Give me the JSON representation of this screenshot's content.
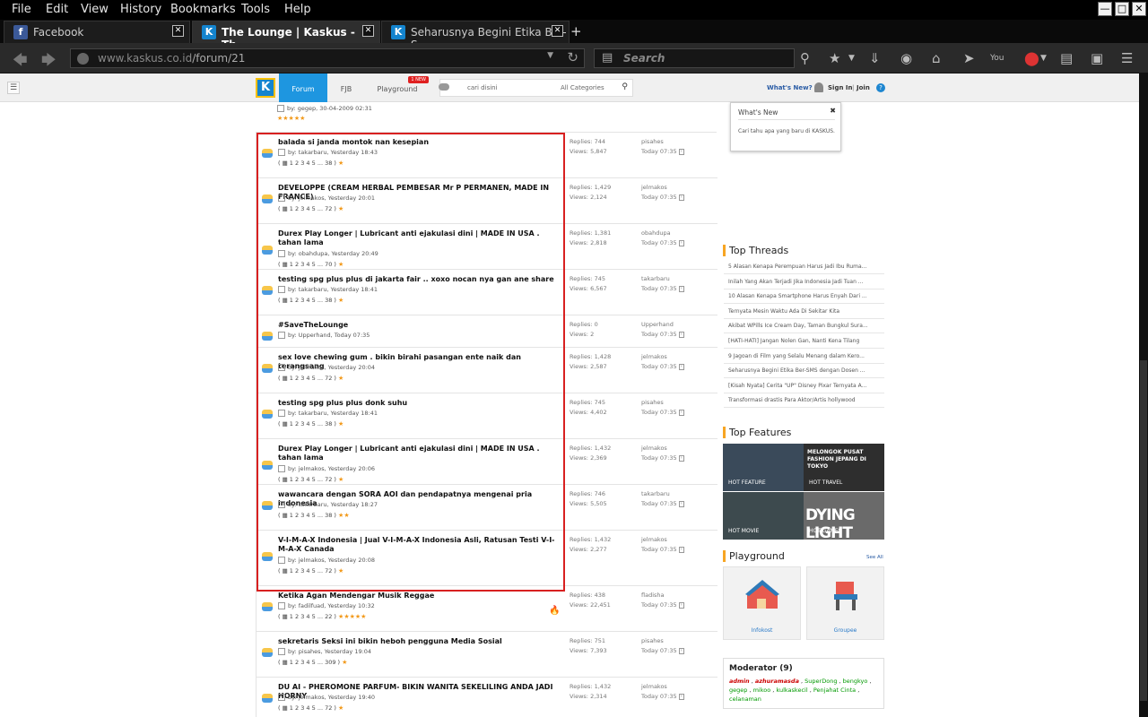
{
  "menu": [
    "File",
    "Edit",
    "View",
    "History",
    "Bookmarks",
    "Tools",
    "Help"
  ],
  "window_controls": [
    "—",
    "□",
    "✕"
  ],
  "tabs": [
    {
      "label": "Facebook",
      "icon": "facebook-icon",
      "icon_glyph": "f",
      "icon_color": "#3b5998"
    },
    {
      "label": "The Lounge | Kaskus - Th...",
      "icon": "kaskus-icon",
      "icon_glyph": "K",
      "icon_color": "#1484ce"
    },
    {
      "label": "Seharusnya Begini Etika Ber-S...",
      "icon": "kaskus-icon",
      "icon_glyph": "K",
      "icon_color": "#1484ce"
    }
  ],
  "tab_close": "✕",
  "new_tab": "+",
  "url": {
    "prefix": "www.kaskus.co.id",
    "path": "/forum/21"
  },
  "search_placeholder": "Search",
  "kaskus_nav": {
    "logo": "K",
    "forum": "Forum",
    "fjb": "FJB",
    "playground": "Playground",
    "new_badge": "1 NEW",
    "search_placeholder": "cari disini",
    "category": "All Categories",
    "whats_new": "What's New?",
    "signin": "Sign In",
    "sep": "|",
    "join": "Join",
    "help": "?"
  },
  "partial_row": {
    "meta": "by:  gegep, 30-04-2009 02:31",
    "stars": "★★★★★"
  },
  "threads": [
    {
      "title": "balada si janda montok nan kesepian",
      "by": "by:  takarbaru, Yesterday 18:43",
      "pages": "( ▦ 1  2  3  4  5 ... 38 )",
      "stars": "★",
      "replies": "Replies: 744",
      "views": "Views: 5,847",
      "last_user": "pisahes",
      "last_time": "Today 07:35"
    },
    {
      "title": "DEVELOPPE (CREAM HERBAL PEMBESAR Mr P PERMANEN, MADE IN FRANCE)",
      "by": "by:  jelmakos, Yesterday 20:01",
      "pages": "( ▦ 1  2  3  4  5 ... 72 )",
      "stars": "★",
      "replies": "Replies: 1,429",
      "views": "Views: 2,124",
      "last_user": "jelmakos",
      "last_time": "Today 07:35"
    },
    {
      "title": "Durex Play Longer | Lubricant anti ejakulasi dini | MADE IN USA . tahan lama",
      "by": "by:  obahdupa, Yesterday 20:49",
      "pages": "( ▦ 1  2  3  4  5 ... 70 )",
      "stars": "★",
      "replies": "Replies: 1,381",
      "views": "Views: 2,818",
      "last_user": "obahdupa",
      "last_time": "Today 07:35"
    },
    {
      "title": "testing spg plus plus di jakarta fair .. xoxo nocan nya gan ane share",
      "by": "by:  takarbaru, Yesterday 18:41",
      "pages": "( ▦ 1  2  3  4  5 ... 38 )",
      "stars": "★",
      "replies": "Replies: 745",
      "views": "Views: 6,567",
      "last_user": "takarbaru",
      "last_time": "Today 07:35"
    },
    {
      "title": "#SaveTheLounge",
      "by": "by:  Upperhand, Today 07:35",
      "pages": "",
      "stars": "",
      "replies": "Replies: 0",
      "views": "Views: 2",
      "last_user": "Upperhand",
      "last_time": "Today 07:35"
    },
    {
      "title": "sex love chewing gum . bikin birahi pasangan ente naik dan terangsang",
      "by": "by:  jelmakos, Yesterday 20:04",
      "pages": "( ▦ 1  2  3  4  5 ... 72 )",
      "stars": "★",
      "replies": "Replies: 1,428",
      "views": "Views: 2,587",
      "last_user": "jelmakos",
      "last_time": "Today 07:35"
    },
    {
      "title": "testing spg plus plus donk suhu",
      "by": "by:  takarbaru, Yesterday 18:41",
      "pages": "( ▦ 1  2  3  4  5 ... 38 )",
      "stars": "★",
      "replies": "Replies: 745",
      "views": "Views: 4,402",
      "last_user": "pisahes",
      "last_time": "Today 07:35"
    },
    {
      "title": "Durex Play Longer | Lubricant anti ejakulasi dini | MADE IN USA . tahan lama",
      "by": "by:  jelmakos, Yesterday 20:06",
      "pages": "( ▦ 1  2  3  4  5 ... 72 )",
      "stars": "★",
      "replies": "Replies: 1,432",
      "views": "Views: 2,369",
      "last_user": "jelmakos",
      "last_time": "Today 07:35"
    },
    {
      "title": "wawancara dengan SORA AOI dan pendapatnya mengenai pria indonesia",
      "by": "by:  takarbaru, Yesterday 18:27",
      "pages": "( ▦ 1  2  3  4  5 ... 38 )",
      "stars": "★★",
      "replies": "Replies: 746",
      "views": "Views: 5,505",
      "last_user": "takarbaru",
      "last_time": "Today 07:35"
    },
    {
      "title": "V-I-M-A-X Indonesia | Jual V-I-M-A-X Indonesia Asli, Ratusan Testi V-I-M-A-X Canada",
      "by": "by:  jelmakos, Yesterday 20:08",
      "pages": "( ▦ 1  2  3  4  5 ... 72 )",
      "stars": "★",
      "replies": "Replies: 1,432",
      "views": "Views: 2,277",
      "last_user": "jelmakos",
      "last_time": "Today 07:35"
    },
    {
      "title": "Ketika Agan Mendengar Musik Reggae",
      "by": "by:  fadilfuad, Yesterday 10:32",
      "pages": "( ▦ 1  2  3  4  5 ... 22 )",
      "stars": "★★★★★",
      "replies": "Replies: 438",
      "views": "Views: 22,451",
      "last_user": "fladisha",
      "last_time": "Today 07:35",
      "hot": "🔥"
    },
    {
      "title": "sekretaris Seksi ini bikin heboh pengguna Media Sosial",
      "by": "by:  pisahes, Yesterday 19:04",
      "pages": "( ▦ 1  2  3  4  5 ... 309 )",
      "stars": "★",
      "replies": "Replies: 751",
      "views": "Views: 7,393",
      "last_user": "pisahes",
      "last_time": "Today 07:35"
    },
    {
      "title": "DU AI - PHEROMONE PARFUM- BIKIN WANITA SEKELILING ANDA JADI HORNY",
      "by": "by:  jelmakos, Yesterday 19:40",
      "pages": "( ▦ 1  2  3  4  5 ... 72 )",
      "stars": "★",
      "replies": "Replies: 1,432",
      "views": "Views: 2,314",
      "last_user": "jelmakos",
      "last_time": "Today 07:35"
    }
  ],
  "whats_new_popup": {
    "title": "What's New",
    "close": "✖",
    "body": "Cari tahu apa yang baru di KASKUS."
  },
  "top_threads": {
    "heading": "Top Threads",
    "items": [
      "5 Alasan Kenapa Perempuan Harus Jadi Ibu Ruma...",
      "Inilah Yang Akan Terjadi Jika Indonesia Jadi Tuan ...",
      "10 Alasan Kenapa Smartphone Harus Enyah Dari ...",
      "Ternyata Mesin Waktu Ada Di Sekitar Kita",
      "Akibat WPills Ice Cream Day, Taman Bungkul Sura...",
      "[HATI-HATI] Jangan Nolen Gan, Nanti Kena Tilang",
      "9 Jagoan di Film yang Selalu Menang dalam Kero...",
      "Seharusnya Begini Etika Ber-SMS dengan Dosen ...",
      "[Kisah Nyata] Cerita \"UP\" Disney Pixar Ternyata A...",
      "Transformasi drastis Para Aktor/Artis hollywood"
    ]
  },
  "top_features": {
    "heading": "Top Features",
    "items": [
      {
        "label": "HOT FEATURE",
        "overlay": "",
        "color": "#3a4a5a"
      },
      {
        "label": "HOT TRAVEL",
        "overlay": "MELONGOK PUSAT FASHION JEPANG DI TOKYO",
        "color": "#2e2e2e"
      },
      {
        "label": "HOT MOVIE",
        "overlay": "",
        "color": "#3d4a4e"
      },
      {
        "label": "HOT GAMES",
        "overlay": "DYING LIGHT",
        "color": "#6a6a6a"
      }
    ]
  },
  "playground": {
    "heading": "Playground",
    "see_all": "See All",
    "items": [
      "Infokost",
      "Groupee"
    ]
  },
  "moderator": {
    "heading": "Moderator (9)",
    "names": [
      {
        "name": "admin",
        "style": "red"
      },
      {
        "name": "azhuramasda",
        "style": "red"
      },
      {
        "name": "SuperDong",
        "style": "grn"
      },
      {
        "name": "bengkyo",
        "style": "grn"
      },
      {
        "name": "gegep",
        "style": "grn"
      },
      {
        "name": "mikoo",
        "style": "grn"
      },
      {
        "name": "kulkaskecil",
        "style": "grn"
      },
      {
        "name": "Penjahat Cinta",
        "style": "grn"
      },
      {
        "name": "celanaman",
        "style": "grn"
      }
    ]
  }
}
